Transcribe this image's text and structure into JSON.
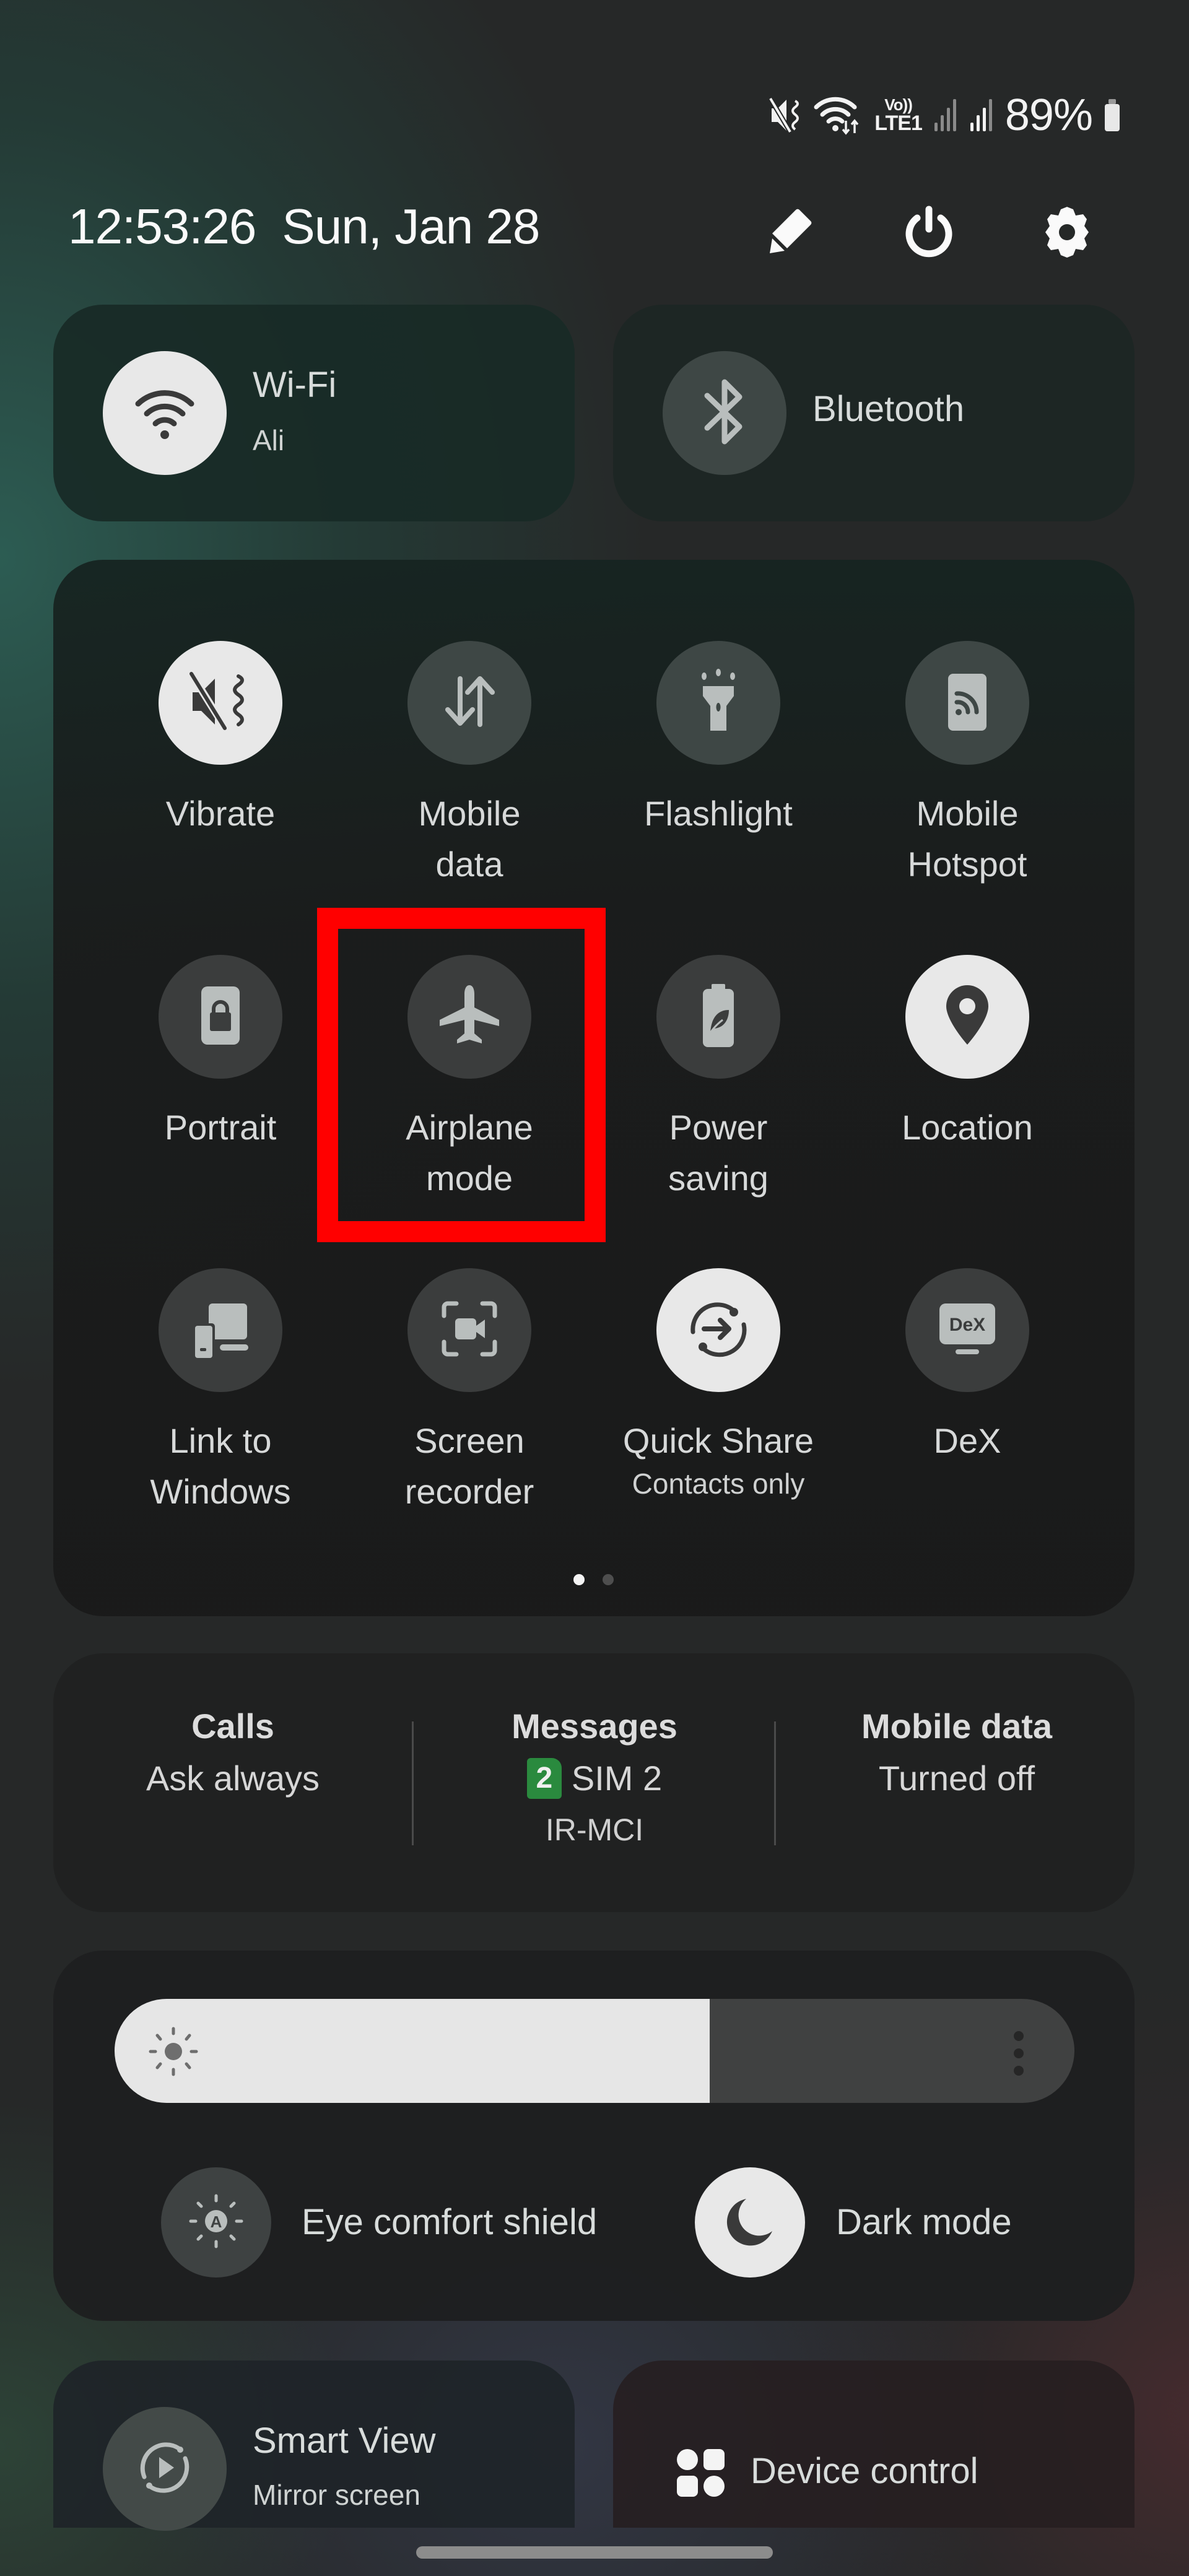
{
  "status_bar": {
    "icons": [
      "vibrate-mute-icon",
      "wifi-data-icon",
      "volte-lte-icon",
      "signal-sim1-icon",
      "signal-sim2-icon",
      "battery-icon"
    ],
    "volte_top": "Vo))",
    "volte_bottom": "LTE1",
    "battery_percent": "89%"
  },
  "header": {
    "time": "12:53:26",
    "date": "Sun, Jan 28",
    "actions": [
      {
        "name": "edit",
        "icon": "pencil-icon"
      },
      {
        "name": "power",
        "icon": "power-icon"
      },
      {
        "name": "settings",
        "icon": "gear-icon"
      }
    ]
  },
  "top_pills": {
    "wifi": {
      "title": "Wi-Fi",
      "subtitle": "Ali",
      "state": "on"
    },
    "bluetooth": {
      "title": "Bluetooth",
      "state": "off"
    }
  },
  "tiles": [
    {
      "label": "Vibrate",
      "icon": "vibrate-icon",
      "state": "on"
    },
    {
      "label": "Mobile\ndata",
      "icon": "mobile-data-icon",
      "state": "off"
    },
    {
      "label": "Flashlight",
      "icon": "flashlight-icon",
      "state": "off"
    },
    {
      "label": "Mobile\nHotspot",
      "icon": "hotspot-icon",
      "state": "off"
    },
    {
      "label": "Portrait",
      "icon": "portrait-lock-icon",
      "state": "off"
    },
    {
      "label": "Airplane\nmode",
      "icon": "airplane-icon",
      "state": "off"
    },
    {
      "label": "Power\nsaving",
      "icon": "power-saving-icon",
      "state": "off"
    },
    {
      "label": "Location",
      "icon": "location-icon",
      "state": "on"
    },
    {
      "label": "Link to\nWindows",
      "icon": "link-to-windows-icon",
      "state": "off"
    },
    {
      "label": "Screen\nrecorder",
      "icon": "screen-recorder-icon",
      "state": "off"
    },
    {
      "label": "Quick Share",
      "sublabel": "Contacts only",
      "icon": "quick-share-icon",
      "state": "on"
    },
    {
      "label": "DeX",
      "icon": "dex-icon",
      "state": "off"
    }
  ],
  "pager": {
    "current_page": 1,
    "total_pages": 2
  },
  "sim_manager": {
    "calls": {
      "title": "Calls",
      "value": "Ask always"
    },
    "messages": {
      "title": "Messages",
      "sim_badge": "2",
      "value": "SIM 2",
      "carrier": "IR-MCI"
    },
    "mobile_data": {
      "title": "Mobile data",
      "value": "Turned off"
    }
  },
  "brightness": {
    "level_percent": 62
  },
  "display_toggles": {
    "eye_comfort": {
      "label": "Eye comfort shield",
      "state": "off"
    },
    "dark_mode": {
      "label": "Dark mode",
      "state": "on"
    }
  },
  "bottom_pills": {
    "smart_view": {
      "title": "Smart View",
      "subtitle": "Mirror screen"
    },
    "device_control": {
      "title": "Device control"
    }
  },
  "annotation": {
    "highlighted_tile": "Airplane mode",
    "color": "#ff0000"
  },
  "colors": {
    "tile_on": "#e8e8e8",
    "tile_off": "#3b3d3d",
    "sim_badge": "#2a8a3e"
  }
}
